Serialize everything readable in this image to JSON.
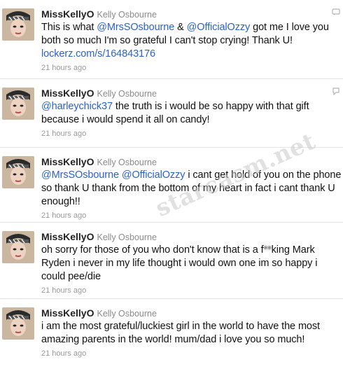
{
  "watermark": "starcasm.net",
  "tweets": [
    {
      "screen_name": "MissKellyO",
      "full_name": "Kelly Osbourne",
      "segments": [
        {
          "type": "text",
          "value": "This is what "
        },
        {
          "type": "mention",
          "value": "@MrsSOsbourne"
        },
        {
          "type": "text",
          "value": " & "
        },
        {
          "type": "mention",
          "value": "@OfficialOzzy"
        },
        {
          "type": "text",
          "value": " got me I love you both so much I'm so grateful I can't stop crying! Thank U! "
        },
        {
          "type": "link",
          "value": "lockerz.com/s/164843176"
        }
      ],
      "timestamp": "21 hours ago",
      "corner_icon": "retweet-icon"
    },
    {
      "screen_name": "MissKellyO",
      "full_name": "Kelly Osbourne",
      "segments": [
        {
          "type": "mention",
          "value": "@harleychick37"
        },
        {
          "type": "text",
          "value": " the truth is i would be so happy with that gift because i would spend it all on candy!"
        }
      ],
      "timestamp": "21 hours ago",
      "corner_icon": "reply-icon"
    },
    {
      "screen_name": "MissKellyO",
      "full_name": "Kelly Osbourne",
      "segments": [
        {
          "type": "mention",
          "value": "@MrsSOsbourne"
        },
        {
          "type": "text",
          "value": " "
        },
        {
          "type": "mention",
          "value": "@OfficialOzzy"
        },
        {
          "type": "text",
          "value": " i cant get hold of you on the phone so thank U thank from the bottom of my heart in fact i cant thank U enough!!"
        }
      ],
      "timestamp": "21 hours ago",
      "corner_icon": ""
    },
    {
      "screen_name": "MissKellyO",
      "full_name": "Kelly Osbourne",
      "segments": [
        {
          "type": "text",
          "value": "oh sorry for those of you who don't know that is a f"
        },
        {
          "type": "blur",
          "value": "**"
        },
        {
          "type": "text",
          "value": "king Mark Ryden i never in my life thought i would own one im so happy i could pee/die"
        }
      ],
      "timestamp": "21 hours ago",
      "corner_icon": ""
    },
    {
      "screen_name": "MissKellyO",
      "full_name": "Kelly Osbourne",
      "segments": [
        {
          "type": "text",
          "value": "i am the most grateful/luckiest girl in the world to have the most amazing parents in the world! mum/dad i love you so much!"
        }
      ],
      "timestamp": "21 hours ago",
      "corner_icon": ""
    }
  ]
}
